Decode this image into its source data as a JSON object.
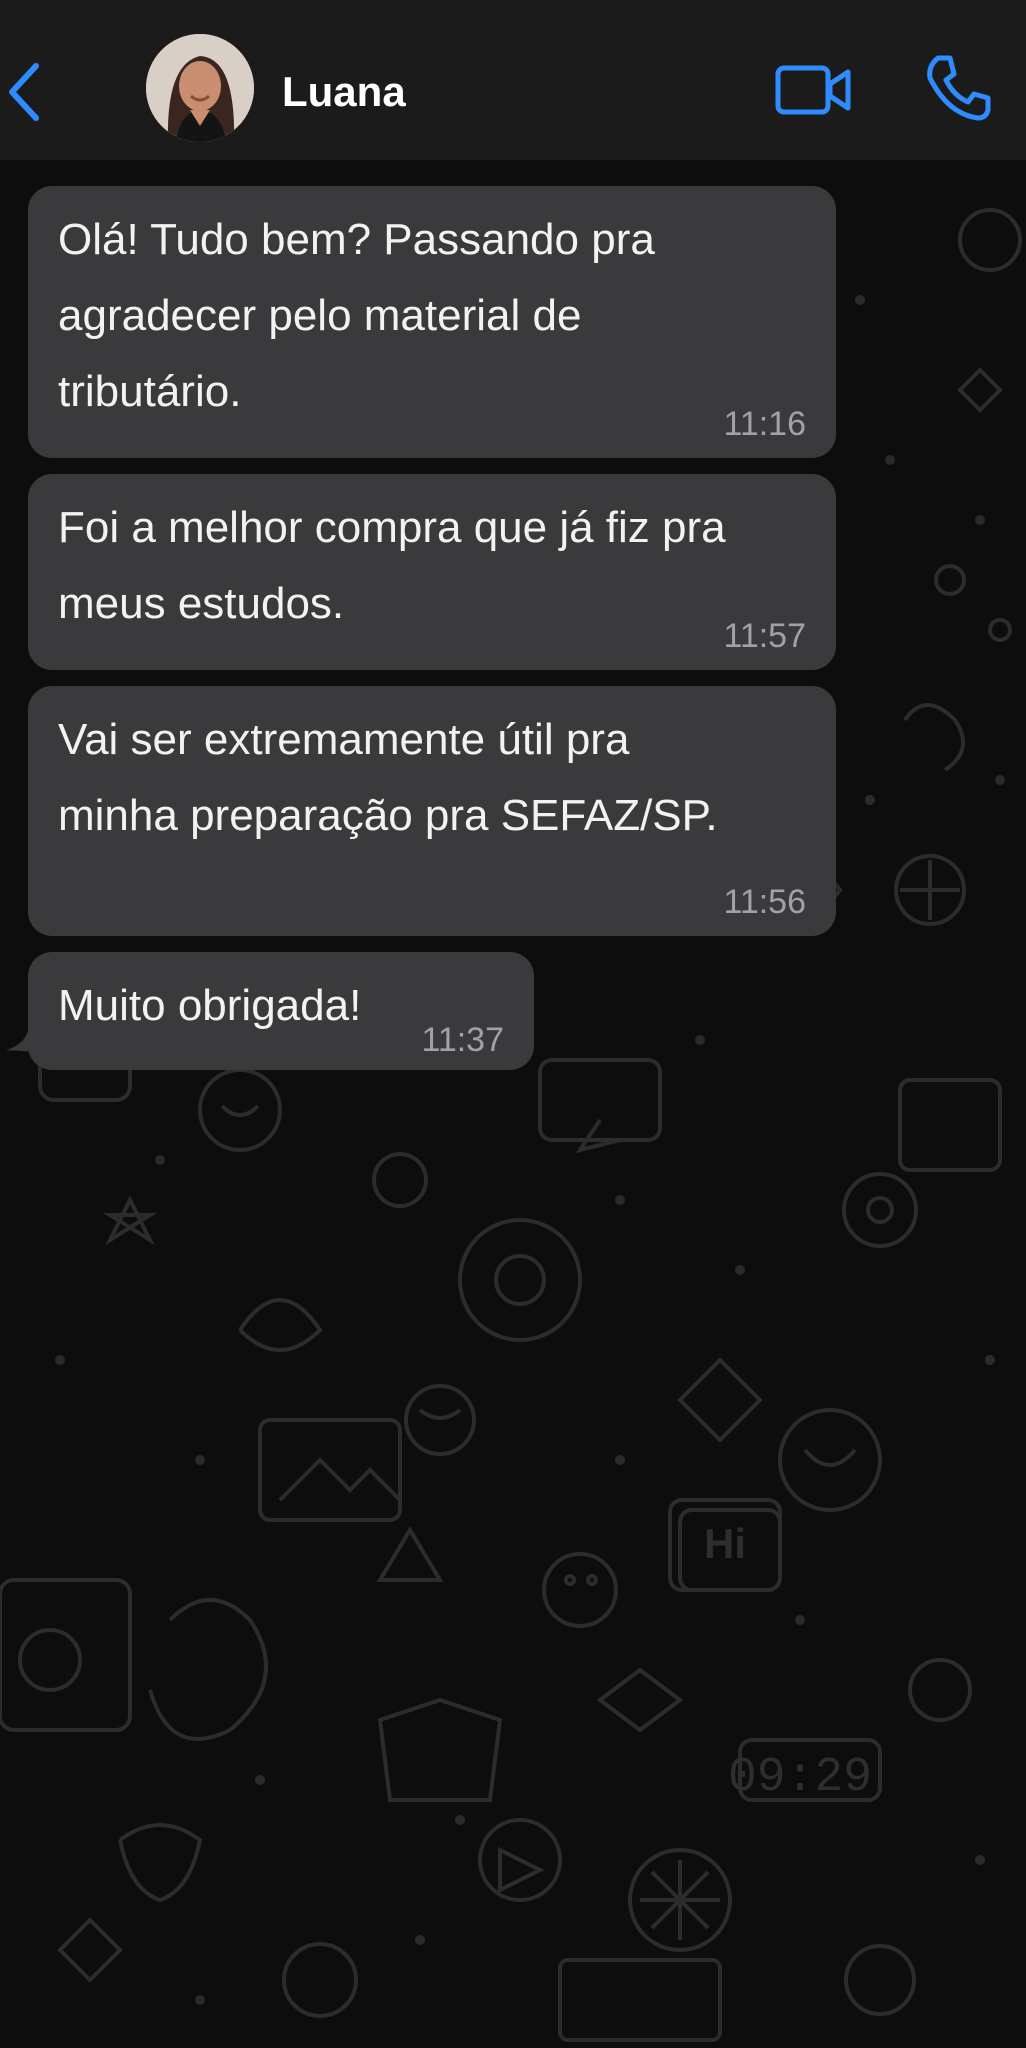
{
  "header": {
    "contact_name": "Luana"
  },
  "icons": {
    "back": "chevron-left-icon",
    "video": "video-camera-icon",
    "call": "phone-icon"
  },
  "colors": {
    "accent": "#2f8cff",
    "bubble": "#3a3a3c",
    "header": "#1b1b1b",
    "background": "#0d0d0d"
  },
  "messages": [
    {
      "text": "Olá! Tudo bem? Passando pra\nagradecer pelo material de\ntributário.",
      "time": "11:16"
    },
    {
      "text": "Foi a melhor compra que já fiz pra\nmeus estudos.",
      "time": "11:57"
    },
    {
      "text": "Vai ser extremamente útil pra\nminha preparação pra SEFAZ/SP.",
      "time": "11:56"
    },
    {
      "text": "Muito obrigada!",
      "time": "11:37"
    }
  ],
  "wallpaper": {
    "hi_badge": "Hi",
    "clock_face": "09:29"
  }
}
